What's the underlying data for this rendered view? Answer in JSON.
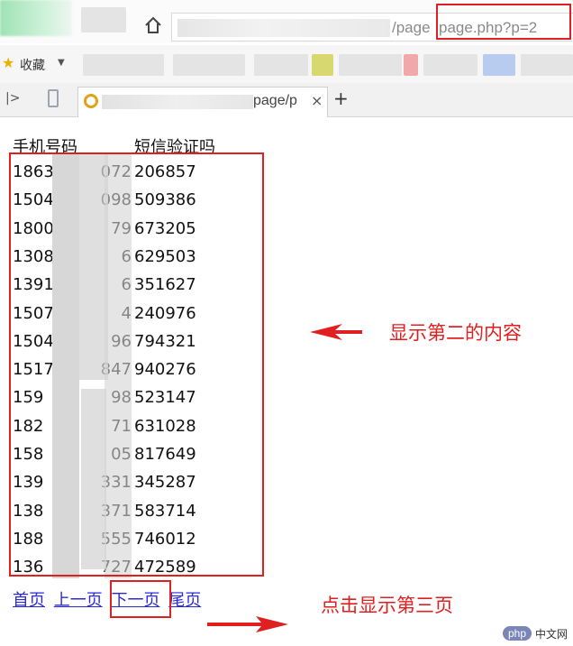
{
  "browser": {
    "address_path": "/page",
    "address_param": "page.php?p=2",
    "favorites_label": "收藏",
    "tab_title": "page/p",
    "new_tab_symbol": "+",
    "close_symbol": "×"
  },
  "table": {
    "headers": [
      "手机号码",
      "短信验证吗"
    ],
    "rows": [
      {
        "phone": "1863",
        "phone_tail": "072",
        "code": "206857"
      },
      {
        "phone": "1504",
        "phone_tail": "098",
        "code": "509386"
      },
      {
        "phone": "1800",
        "phone_tail": "79",
        "code": "673205"
      },
      {
        "phone": "1308",
        "phone_tail": "6",
        "code": "629503"
      },
      {
        "phone": "1391",
        "phone_tail": "6",
        "code": "351627"
      },
      {
        "phone": "1507",
        "phone_tail": "4",
        "code": "240976"
      },
      {
        "phone": "1504",
        "phone_tail": "96",
        "code": "794321"
      },
      {
        "phone": "1517",
        "phone_tail": "847",
        "code": "940276"
      },
      {
        "phone": "159",
        "phone_tail": "98",
        "code": "523147"
      },
      {
        "phone": "182",
        "phone_tail": "71",
        "code": "631028"
      },
      {
        "phone": "158",
        "phone_tail": "05",
        "code": "817649"
      },
      {
        "phone": "139",
        "phone_tail": "331",
        "code": "345287"
      },
      {
        "phone": "138",
        "phone_tail": "371",
        "code": "583714"
      },
      {
        "phone": "188",
        "phone_tail": "555",
        "code": "746012"
      },
      {
        "phone": "136",
        "phone_tail": "727",
        "code": "472589"
      }
    ]
  },
  "pager": {
    "first": "首页",
    "prev": "上一页",
    "next": "下一页",
    "last": "尾页"
  },
  "annotations": {
    "content_note": "显示第二的内容",
    "click_note": "点击显示第三页"
  },
  "watermark": {
    "php": "php",
    "cn": "中文网"
  },
  "colors": {
    "annotation_red": "#e02020",
    "link_blue": "#2b2bd8"
  }
}
